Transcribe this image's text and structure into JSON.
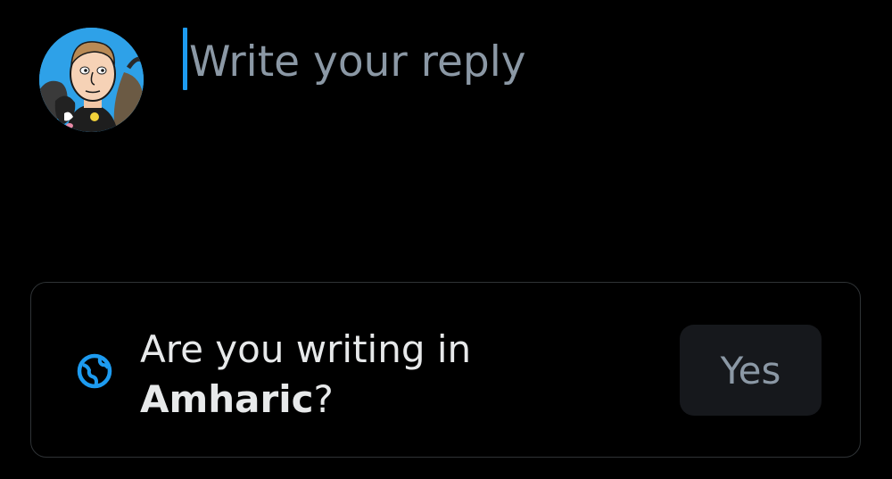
{
  "composer": {
    "avatar_icon": "user-avatar-cartoon",
    "reply_placeholder": "Write your reply",
    "reply_value": ""
  },
  "language_prompt": {
    "icon": "globe-icon",
    "question_prefix": "Are you writing in",
    "language": "Amharic",
    "question_suffix": "?",
    "yes_label": "Yes"
  },
  "colors": {
    "background": "#000000",
    "accent": "#1d9bf0",
    "text_primary": "#e7e9ea",
    "text_secondary": "#8b98a5",
    "card_border": "#2f3336",
    "button_bg": "#16181c"
  }
}
